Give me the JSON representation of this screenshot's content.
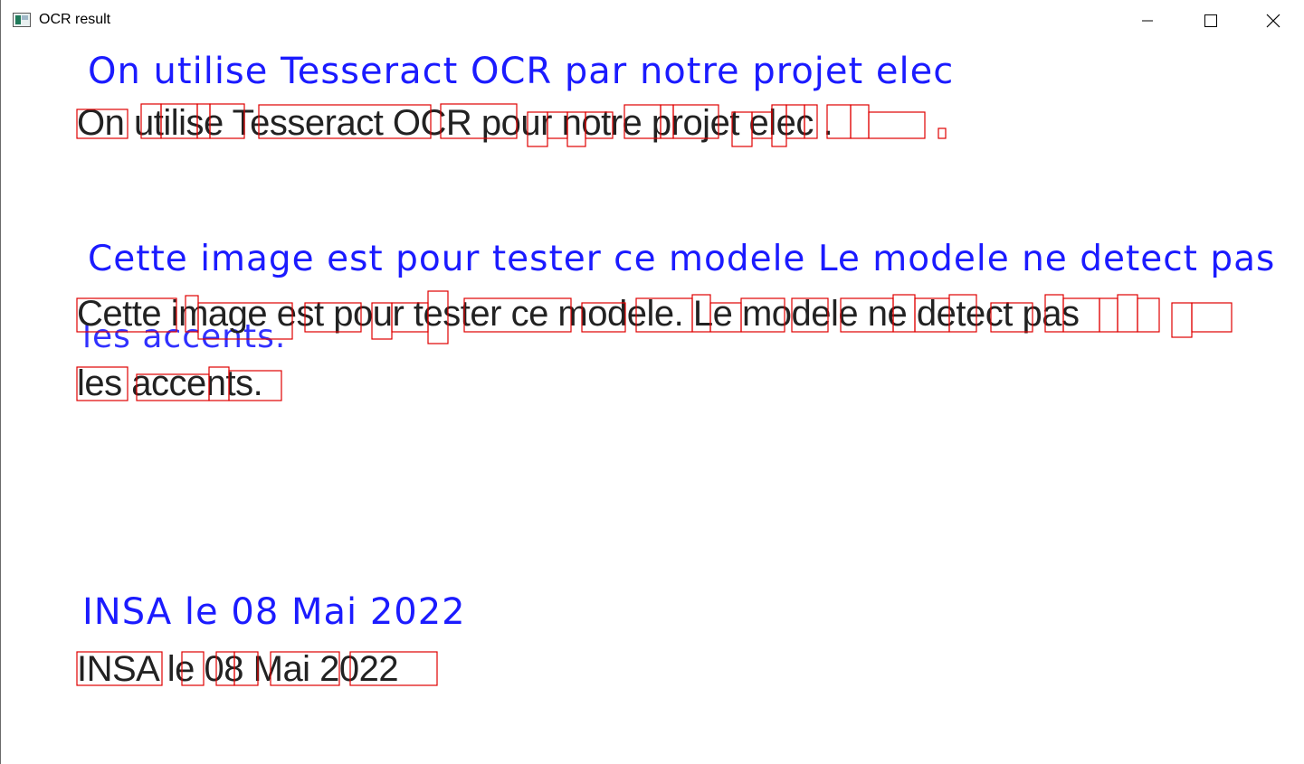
{
  "window": {
    "title": "OCR result",
    "app_icon": "image-window-icon",
    "controls": {
      "minimize_icon": "minimize-icon",
      "maximize_icon": "maximize-icon",
      "close_icon": "close-icon"
    }
  },
  "ocr": {
    "recognized_lines": [
      "On utilise Tesseract OCR par notre projet elec",
      "Cette image est pour tester ce modele Le modele ne detect pas",
      "les accents.",
      "INSA le 08 Mai 2022"
    ],
    "source_lines": [
      "On utilise Tesseract OCR pour notre projet elec .",
      "Cette image est pour tester ce modele. Le modele ne detect pas",
      "les accents.",
      "INSA le 08 Mai 2022"
    ],
    "colors": {
      "recognized_text": "#1b1bff",
      "bounding_box": "#e00000",
      "source_text": "#222222"
    }
  }
}
